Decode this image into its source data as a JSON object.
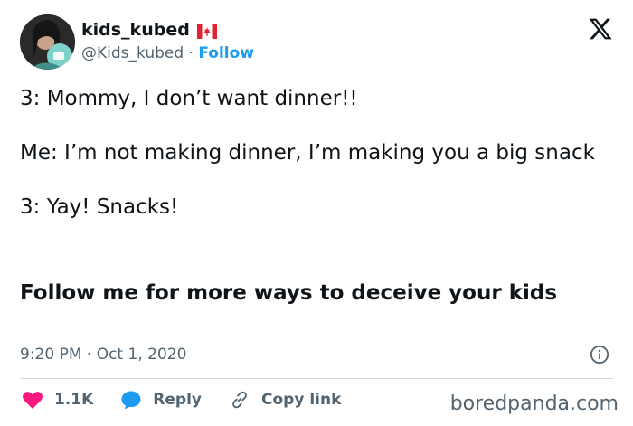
{
  "author": {
    "display_name": "kids_kubed",
    "flag_icon": "canada-flag-icon",
    "handle": "@Kids_kubed",
    "separator": "·",
    "follow_label": "Follow"
  },
  "tweet": {
    "lines": [
      "3: Mommy, I don’t want dinner!!",
      "Me: I’m not making dinner, I’m making you a big snack",
      "3: Yay! Snacks!"
    ],
    "bold_line": "Follow me for more ways to deceive your kids"
  },
  "meta": {
    "timestamp": "9:20 PM · Oct 1, 2020"
  },
  "actions": {
    "likes": "1.1K",
    "reply_label": "Reply",
    "copy_link_label": "Copy link"
  },
  "watermark": "boredpanda.com",
  "colors": {
    "accent": "#1d9bf0",
    "like": "#f91880",
    "muted": "#536471"
  }
}
